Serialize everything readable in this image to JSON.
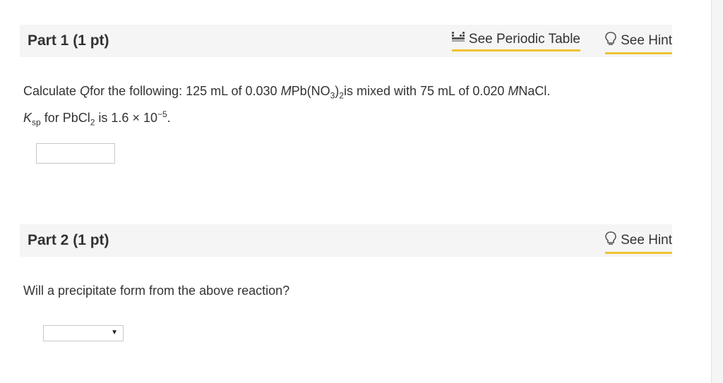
{
  "part1": {
    "title": "Part 1 (1 pt)",
    "periodic_table_label": "See Periodic Table",
    "hint_label": "See Hint",
    "question": {
      "t1": "Calculate ",
      "q": "Q",
      "t2": "for the following: 125 mL of 0.030 ",
      "m1": "M",
      "t3": "Pb(NO",
      "sub3": "3",
      "t4": ")",
      "sub2a": "2",
      "t5": "is mixed with 75 mL of 0.020 ",
      "m2": "M",
      "t6": "NaCl.",
      "ksp_k": "K",
      "ksp_sub": "sp",
      "t7": " for PbCl",
      "sub2b": "2",
      "t8": " is 1.6 × 10",
      "exp": "−5",
      "t9": "."
    },
    "answer_value": ""
  },
  "part2": {
    "title": "Part 2 (1 pt)",
    "hint_label": "See Hint",
    "question": "Will a precipitate form from the above reaction?",
    "select_value": ""
  },
  "icons": {
    "hint": "lightbulb-icon",
    "periodic_table": "periodic-table-icon",
    "select_arrow": "caret-down-icon"
  },
  "colors": {
    "accent_underline": "#f1c232",
    "header_bg": "#f5f5f5",
    "text": "#333333"
  }
}
